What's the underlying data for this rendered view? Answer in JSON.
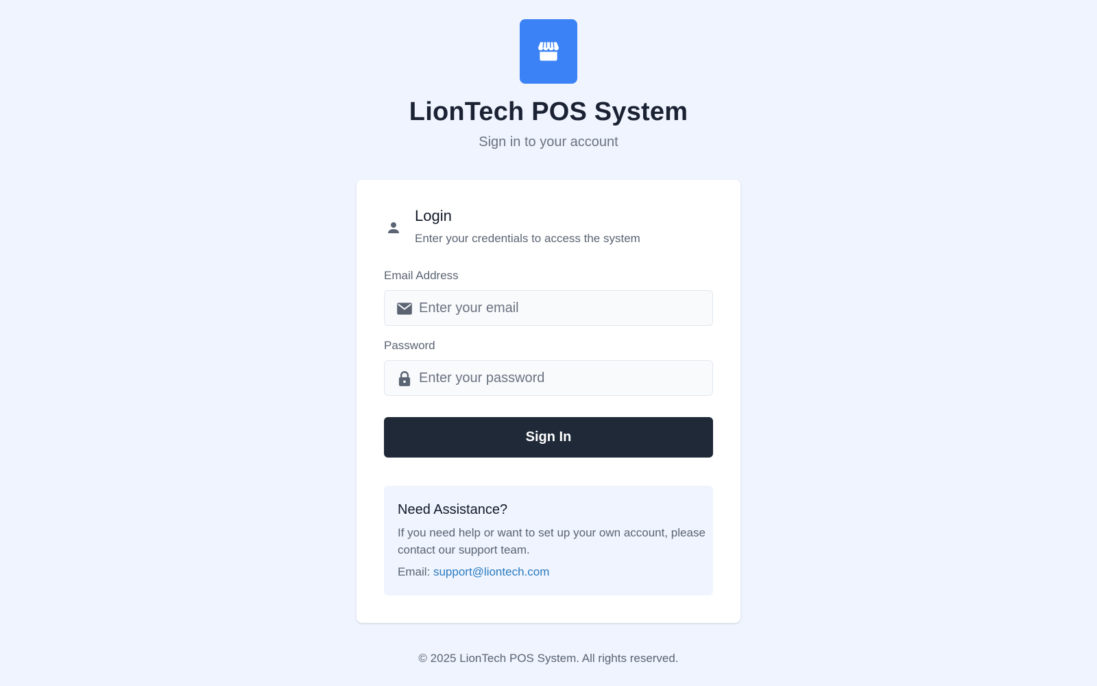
{
  "header": {
    "logo_icon": "storefront-icon",
    "title": "LionTech POS System",
    "subtitle": "Sign in to your account"
  },
  "login_card": {
    "icon": "user-icon",
    "title": "Login",
    "description": "Enter your credentials to access the system",
    "email": {
      "label": "Email Address",
      "icon": "envelope-icon",
      "placeholder": "Enter your email",
      "value": ""
    },
    "password": {
      "label": "Password",
      "icon": "lock-icon",
      "placeholder": "Enter your password",
      "value": ""
    },
    "submit_label": "Sign In"
  },
  "assistance": {
    "title": "Need Assistance?",
    "text": "If you need help or want to set up your own account, please contact our support team.",
    "email_prefix": "Email: ",
    "email": "support@liontech.com"
  },
  "footer": {
    "copyright": "© 2025 LionTech POS System. All rights reserved."
  },
  "colors": {
    "background": "#eff4fe",
    "brand_blue": "#3b82f6",
    "button_dark": "#1f2937",
    "link": "#2b7bc0"
  }
}
